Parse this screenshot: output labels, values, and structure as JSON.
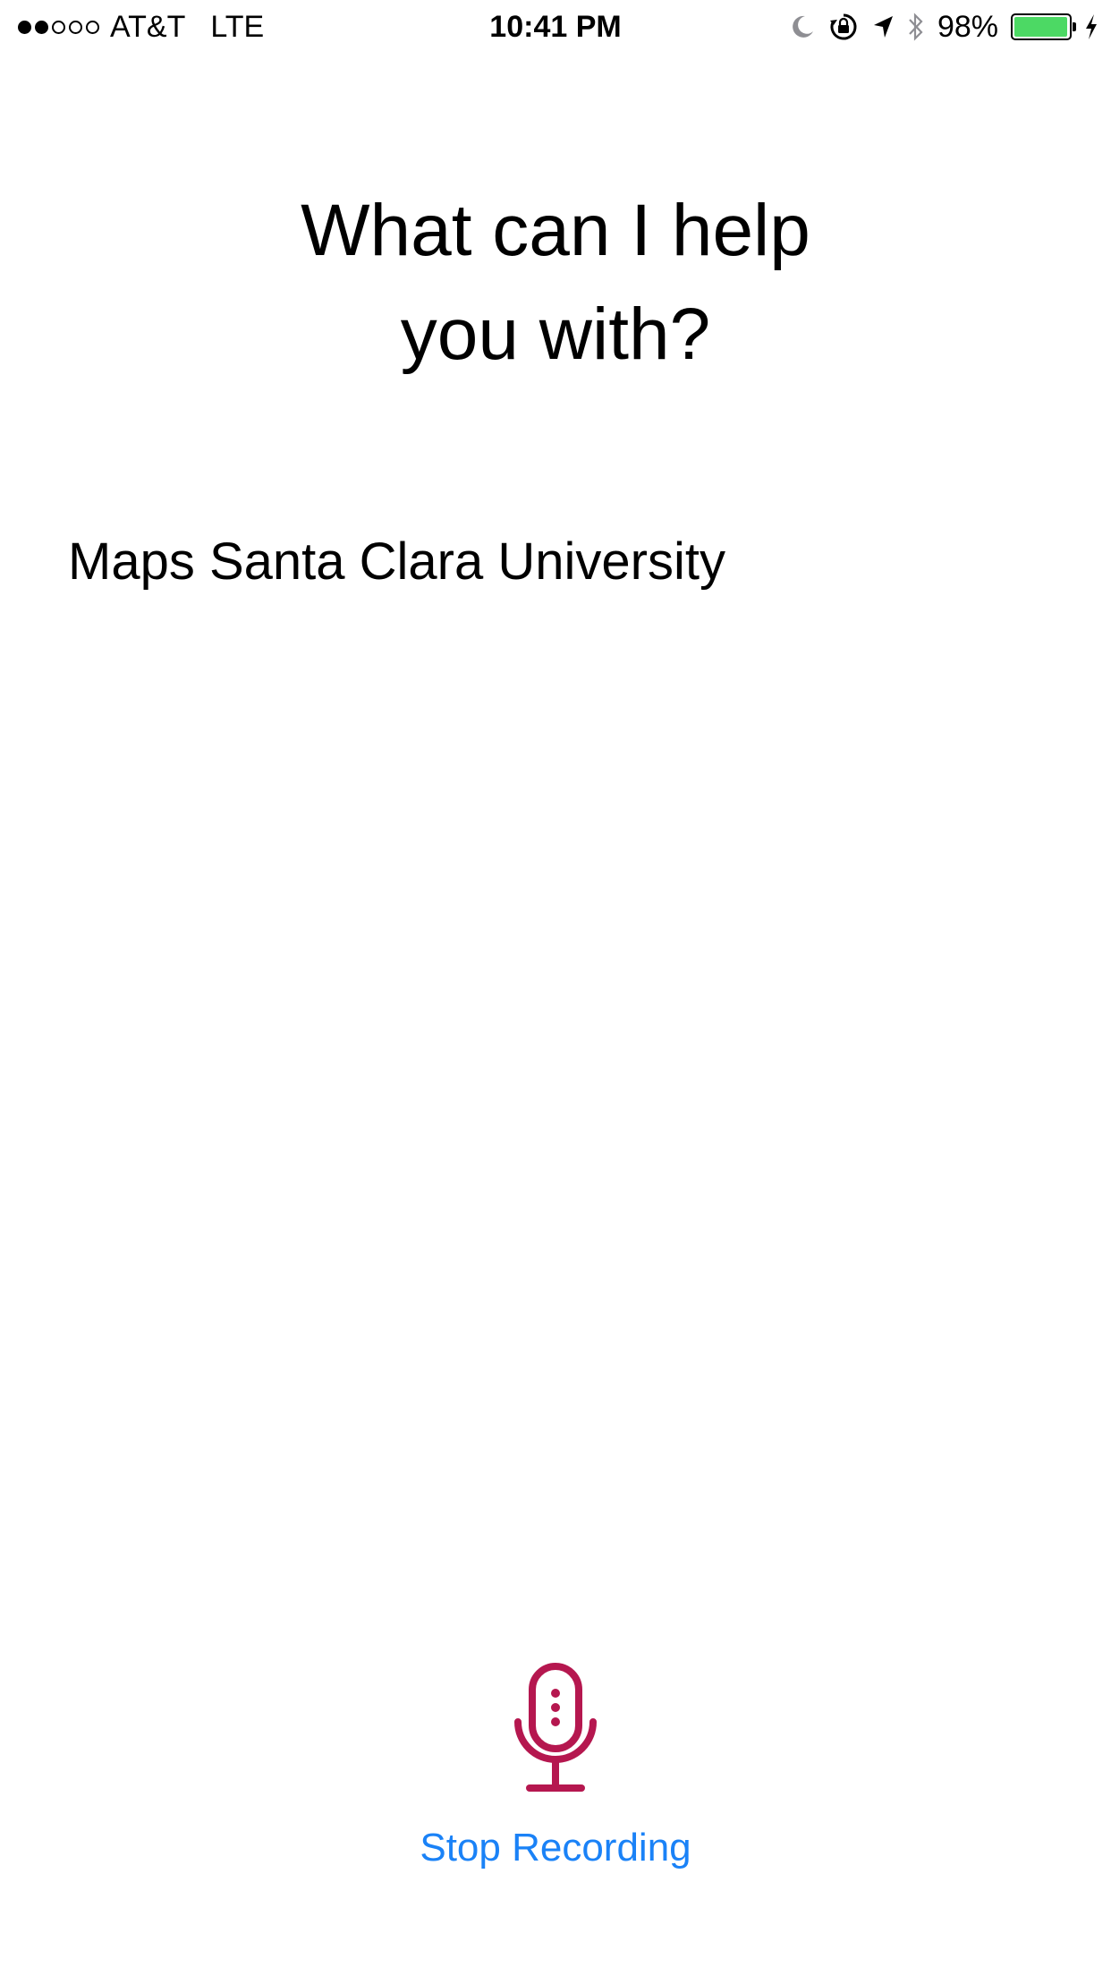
{
  "status_bar": {
    "signal_bars_filled": 2,
    "signal_bars_total": 5,
    "carrier": "AT&T",
    "network": "LTE",
    "time": "10:41 PM",
    "battery_percent": "98%",
    "battery_level": 0.98,
    "icons": [
      "moon-icon",
      "rotation-lock-icon",
      "location-arrow-icon",
      "bluetooth-icon",
      "battery-icon",
      "charging-bolt-icon"
    ],
    "battery_color": "#4cd964"
  },
  "prompt": {
    "line1": "What can I help",
    "line2": "you with?"
  },
  "transcript": "Maps Santa Clara University",
  "mic": {
    "icon": "microphone-icon",
    "color": "#b5174f"
  },
  "stop_button_label": "Stop Recording",
  "accent_color": "#1a82f7"
}
